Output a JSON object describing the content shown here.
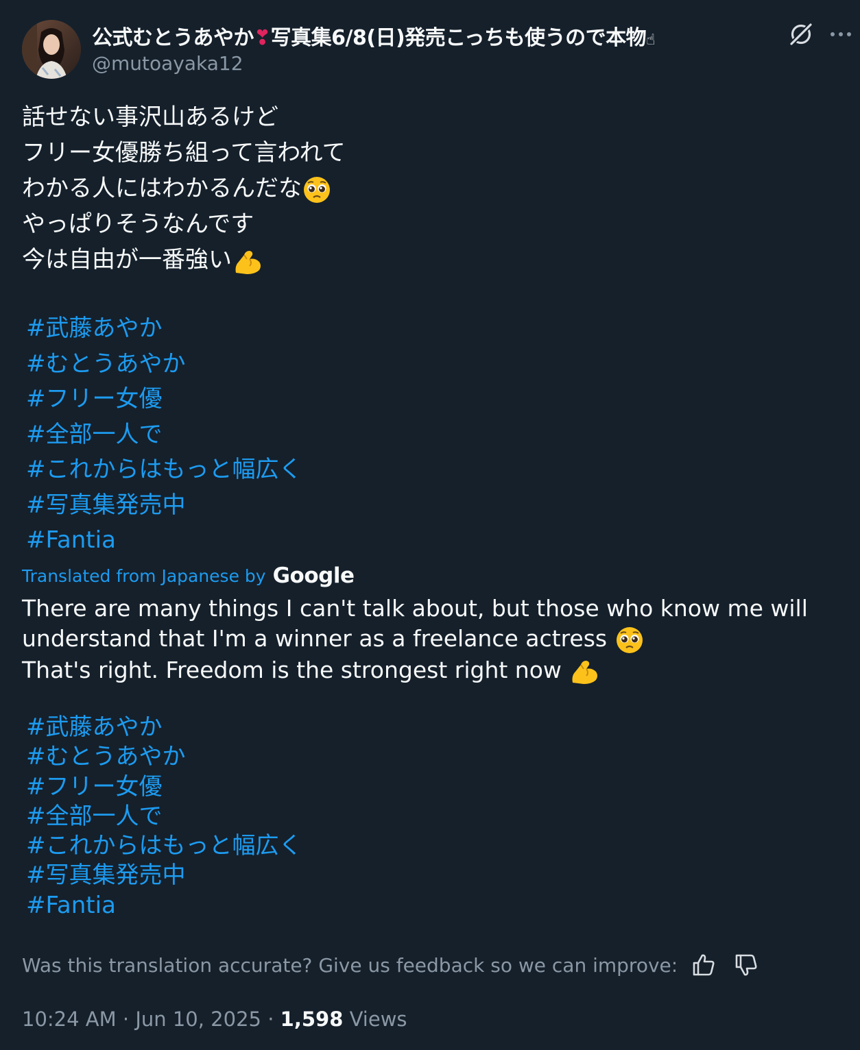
{
  "author": {
    "display_name_pre": "公式むとうあやか",
    "heart": "❣",
    "display_name_post": "写真集6/8(日)発売こっちも使うので本物",
    "display_name_tail": "☝",
    "handle": "@mutoayaka12"
  },
  "original": {
    "lines": [
      "話せない事沢山あるけど",
      "フリー女優勝ち組って言われて",
      "わかる人にはわかるんだな",
      "やっぱりそうなんです",
      "今は自由が一番強い"
    ],
    "hashtags": [
      "#武藤あやか",
      "#むとうあやか",
      "#フリー女優",
      "#全部一人で",
      "#これからはもっと幅広く",
      "#写真集発売中",
      "#Fantia"
    ]
  },
  "translation": {
    "label": "Translated from Japanese by",
    "provider": "Google",
    "paragraph1": "There are many things I can't talk about, but those who know me will understand that I'm a winner as a freelance actress",
    "paragraph2": "That's right. Freedom is the strongest right now",
    "hashtags": [
      "#武藤あやか",
      "#むとうあやか",
      "#フリー女優",
      "#全部一人で",
      "#これからはもっと幅広く",
      "#写真集発売中",
      "#Fantia"
    ],
    "feedback_prompt": "Was this translation accurate? Give us feedback so we can improve:"
  },
  "meta": {
    "time": "10:24 AM",
    "sep1": " · ",
    "date": "Jun 10, 2025",
    "sep2": " · ",
    "views_count": "1,598",
    "views_label": " Views"
  },
  "icons": {
    "grok": "grok-icon",
    "more": "more-icon",
    "thumbs_up": "thumbs-up-icon",
    "thumbs_down": "thumbs-down-icon",
    "pleading_emoji": "pleading-face-emoji",
    "flexed_biceps_emoji": "flexed-biceps-emoji"
  },
  "colors": {
    "background": "#15202b",
    "text": "#f7f9f9",
    "secondary": "#8b98a5",
    "link": "#1d9bf0"
  }
}
